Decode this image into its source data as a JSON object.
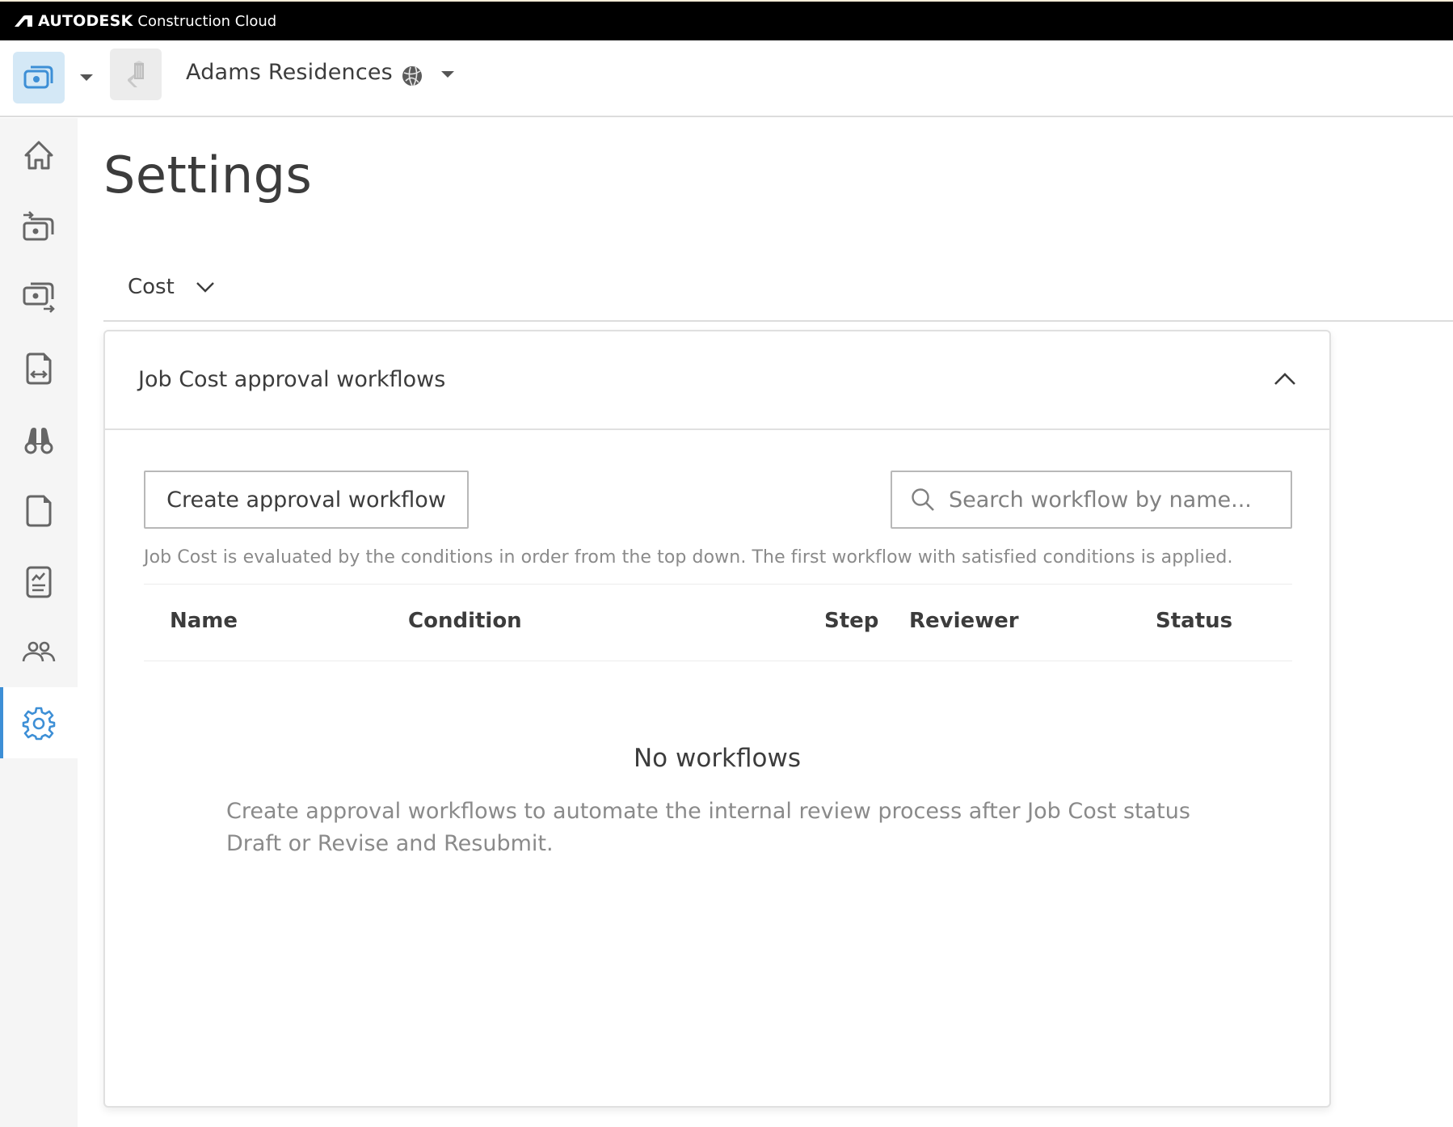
{
  "brand": {
    "strong": "AUTODESK",
    "product": "Construction Cloud"
  },
  "header": {
    "app_switcher_icon": "cost-management-icon",
    "project_thumbnail_icon": "building-icon",
    "project_name": "Adams Residences",
    "project_scope_icon": "globe-icon"
  },
  "sidebar": {
    "items": [
      {
        "icon": "home-icon",
        "label": "Home",
        "active": false
      },
      {
        "icon": "budget-in-icon",
        "label": "Budget",
        "active": false
      },
      {
        "icon": "cost-out-icon",
        "label": "Cost",
        "active": false
      },
      {
        "icon": "change-orders-icon",
        "label": "Change Orders",
        "active": false
      },
      {
        "icon": "binoculars-icon",
        "label": "Forecast",
        "active": false
      },
      {
        "icon": "file-icon",
        "label": "Files",
        "active": false
      },
      {
        "icon": "report-icon",
        "label": "Reports",
        "active": false
      },
      {
        "icon": "members-icon",
        "label": "Members",
        "active": false
      },
      {
        "icon": "gear-icon",
        "label": "Settings",
        "active": true
      }
    ],
    "accent_color": "#3d8fd6"
  },
  "main": {
    "title": "Settings",
    "tab": {
      "label": "Cost",
      "icon": "chevron-down-icon"
    },
    "card": {
      "title": "Job Cost approval workflows",
      "collapse_icon": "chevron-up-icon",
      "create_button": "Create approval workflow",
      "search": {
        "placeholder": "Search workflow by name...",
        "value": ""
      },
      "help_text": "Job Cost is evaluated by the conditions in order from the top down. The first workflow with satisfied conditions is applied.",
      "table": {
        "columns": [
          "Name",
          "Condition",
          "Step",
          "Reviewer",
          "Status"
        ],
        "rows": []
      },
      "empty_state": {
        "title": "No workflows",
        "description": "Create approval workflows to automate the internal review process after Job Cost status Draft or Revise and Resubmit."
      }
    }
  }
}
